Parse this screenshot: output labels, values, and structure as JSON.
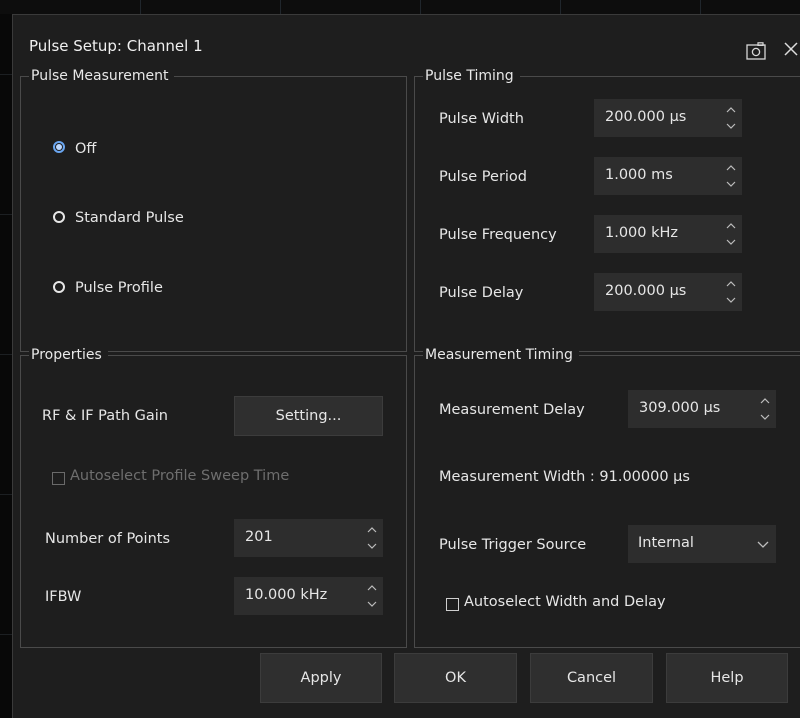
{
  "dialog": {
    "title": "Pulse Setup: Channel 1"
  },
  "pulse_measurement": {
    "legend": "Pulse Measurement",
    "options": [
      {
        "label": "Off",
        "selected": true
      },
      {
        "label": "Standard Pulse",
        "selected": false
      },
      {
        "label": "Pulse Profile",
        "selected": false
      }
    ]
  },
  "pulse_timing": {
    "legend": "Pulse Timing",
    "fields": [
      {
        "label": "Pulse Width",
        "value": "200.000 µs"
      },
      {
        "label": "Pulse Period",
        "value": "1.000 ms"
      },
      {
        "label": "Pulse Frequency",
        "value": "1.000 kHz"
      },
      {
        "label": "Pulse Delay",
        "value": "200.000 µs"
      }
    ]
  },
  "properties": {
    "legend": "Properties",
    "rf_if_label": "RF & IF Path Gain",
    "setting_button": "Setting...",
    "autoselect_profile_label": "Autoselect Profile Sweep Time",
    "num_points_label": "Number of Points",
    "num_points_value": "201",
    "ifbw_label": "IFBW",
    "ifbw_value": "10.000 kHz"
  },
  "measurement_timing": {
    "legend": "Measurement Timing",
    "delay_label": "Measurement Delay",
    "delay_value": "309.000 µs",
    "width_text": "Measurement Width :  91.00000 µs",
    "trigger_label": "Pulse Trigger Source",
    "trigger_value": "Internal",
    "autoselect_label": "Autoselect Width and Delay"
  },
  "buttons": {
    "apply": "Apply",
    "ok": "OK",
    "cancel": "Cancel",
    "help": "Help"
  },
  "icons": {
    "camera": "camera-icon",
    "close": "close-icon",
    "spin": "chevron-up-down-icon",
    "dropdown": "chevron-down-icon"
  },
  "colors": {
    "dialog_bg": "#1e1e1e",
    "field_bg": "#2d2d2d",
    "radio_selected": "#6aa6f0"
  }
}
